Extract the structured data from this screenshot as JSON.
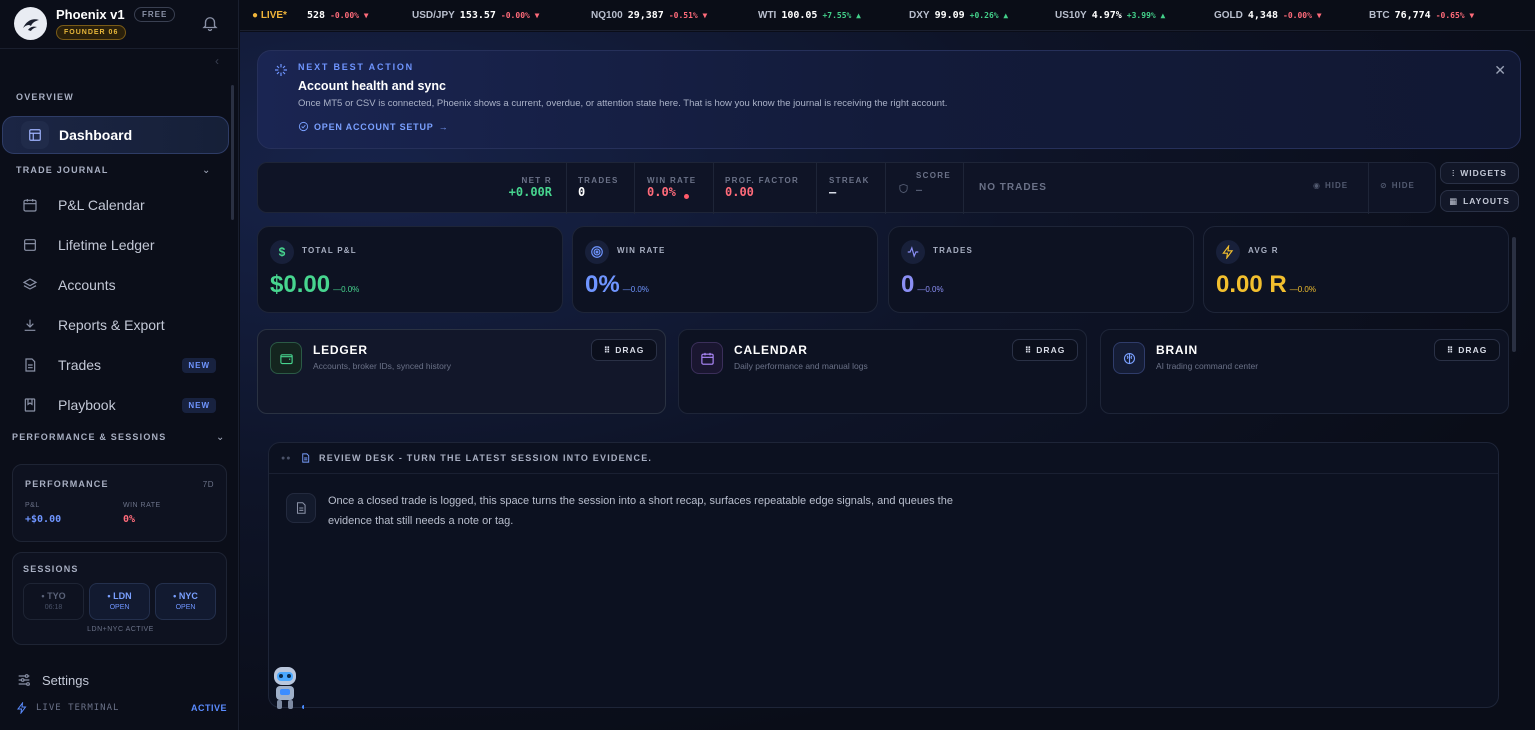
{
  "brand": {
    "name": "Phoenix v1",
    "plan_badge": "FREE",
    "founder_badge": "FOUNDER 06"
  },
  "sidebar": {
    "overview_label": "OVERVIEW",
    "dashboard": "Dashboard",
    "trade_journal_label": "TRADE JOURNAL",
    "items": [
      {
        "label": "P&L Calendar",
        "icon": "calendar-icon"
      },
      {
        "label": "Lifetime Ledger",
        "icon": "ledger-icon"
      },
      {
        "label": "Accounts",
        "icon": "layers-icon"
      },
      {
        "label": "Reports & Export",
        "icon": "download-icon"
      },
      {
        "label": "Trades",
        "icon": "document-icon",
        "badge": "NEW"
      },
      {
        "label": "Playbook",
        "icon": "book-icon",
        "badge": "NEW"
      }
    ],
    "perf_sessions_label": "PERFORMANCE & SESSIONS",
    "performance": {
      "title": "PERFORMANCE",
      "range": "7D",
      "pnl_label": "P&L",
      "pnl_value": "+$0.00",
      "winrate_label": "WIN RATE",
      "winrate_value": "0%"
    },
    "sessions": {
      "title": "SESSIONS",
      "chips": [
        {
          "name": "• TYO",
          "status": "06:18"
        },
        {
          "name": "• LDN",
          "status": "OPEN"
        },
        {
          "name": "• NYC",
          "status": "OPEN"
        }
      ],
      "footer": "LDN+NYC ACTIVE"
    },
    "settings": "Settings",
    "terminal": "LIVE TERMINAL",
    "terminal_status": "ACTIVE"
  },
  "ticker": {
    "live": "LIVE*",
    "items": [
      {
        "symbol": "",
        "price": "528",
        "change": "-0.00% ▼",
        "dir": "neg"
      },
      {
        "symbol": "USD/JPY",
        "price": "153.57",
        "change": "-0.00% ▼",
        "dir": "neg"
      },
      {
        "symbol": "NQ100",
        "price": "29,387",
        "change": "-0.51% ▼",
        "dir": "neg"
      },
      {
        "symbol": "WTI",
        "price": "100.05",
        "change": "+7.55% ▲",
        "dir": "pos"
      },
      {
        "symbol": "DXY",
        "price": "99.09",
        "change": "+0.26% ▲",
        "dir": "pos"
      },
      {
        "symbol": "US10Y",
        "price": "4.97%",
        "change": "+3.99% ▲",
        "dir": "pos"
      },
      {
        "symbol": "GOLD",
        "price": "4,348",
        "change": "-0.00% ▼",
        "dir": "neg"
      },
      {
        "symbol": "BTC",
        "price": "76,774",
        "change": "-0.65% ▼",
        "dir": "neg"
      }
    ]
  },
  "nba": {
    "eyebrow": "NEXT BEST ACTION",
    "title": "Account health and sync",
    "description": "Once MT5 or CSV is connected, Phoenix shows a current, overdue, or attention state here. That is how you know the journal is receiving the right account.",
    "link": "OPEN ACCOUNT SETUP"
  },
  "stats": {
    "net_r_label": "NET R",
    "net_r": "+0.00R",
    "trades_label": "TRADES",
    "trades": "0",
    "winrate_label": "WIN RATE",
    "winrate": "0.0%",
    "pf_label": "PROF. FACTOR",
    "pf": "0.00",
    "streak_label": "STREAK",
    "streak": "—",
    "score_label": "SCORE",
    "score": "—",
    "no_trades": "NO TRADES",
    "hide1": "HIDE",
    "hide2": "HIDE",
    "widgets": "WIDGETS",
    "layouts": "LAYOUTS"
  },
  "kpis": [
    {
      "label": "TOTAL P&L",
      "value": "$0.00",
      "delta": "—0.0%",
      "color": "#47d58f"
    },
    {
      "label": "WIN RATE",
      "value": "0%",
      "delta": "—0.0%",
      "color": "#6f95ff"
    },
    {
      "label": "TRADES",
      "value": "0",
      "delta": "—0.0%",
      "color": "#8b8ff5"
    },
    {
      "label": "AVG R",
      "value": "0.00 R",
      "delta": "—0.0%",
      "color": "#f2bf2e"
    }
  ],
  "widgets": [
    {
      "title": "LEDGER",
      "subtitle": "Accounts, broker IDs, synced history",
      "drag": "DRAG"
    },
    {
      "title": "CALENDAR",
      "subtitle": "Daily performance and manual logs",
      "drag": "DRAG"
    },
    {
      "title": "BRAIN",
      "subtitle": "AI trading command center",
      "drag": "DRAG"
    }
  ],
  "review": {
    "title": "REVIEW DESK - TURN THE LATEST SESSION INTO EVIDENCE.",
    "body": "Once a closed trade is logged, this space turns the session into a short recap, surfaces repeatable edge signals, and queues the evidence that still needs a note or tag."
  }
}
